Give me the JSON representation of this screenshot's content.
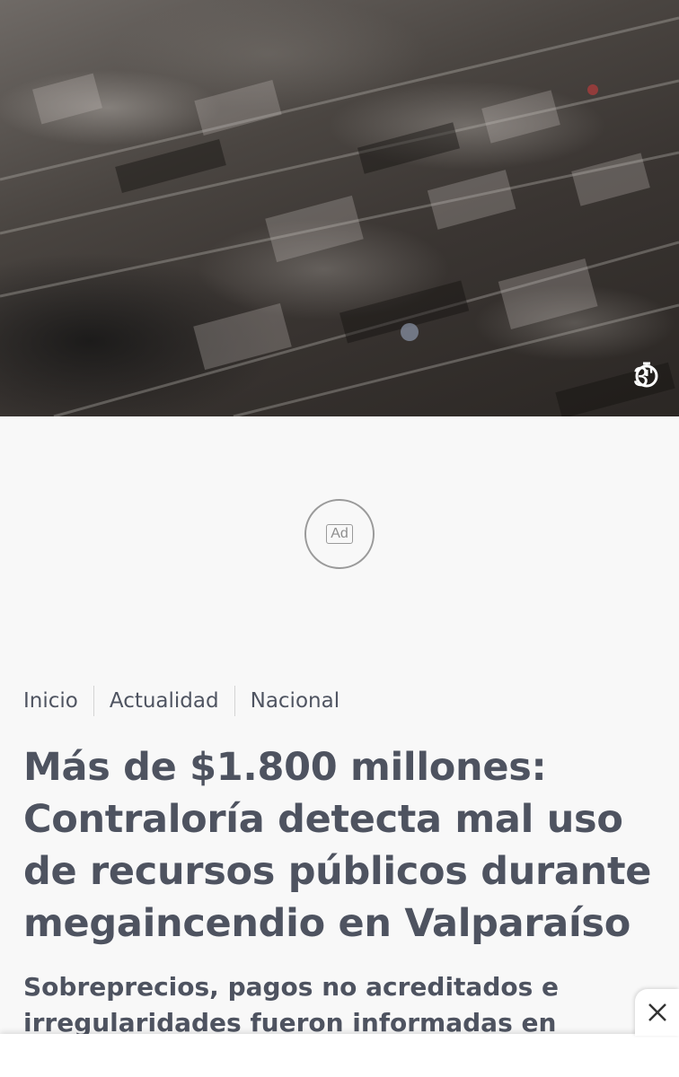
{
  "hero": {
    "read_time": "3'",
    "clock_icon": "stopwatch-icon"
  },
  "ad": {
    "label": "Ad"
  },
  "breadcrumb": [
    {
      "label": "Inicio"
    },
    {
      "label": "Actualidad"
    },
    {
      "label": "Nacional"
    }
  ],
  "article": {
    "headline": "Más de $1.800 millones: Contraloría detecta mal uso de recursos públicos durante megaincendio en Valparaíso",
    "subtitle": "Sobreprecios, pagos no acreditados e irregularidades fueron informadas en"
  },
  "overlay": {
    "close_icon": "close-icon"
  }
}
